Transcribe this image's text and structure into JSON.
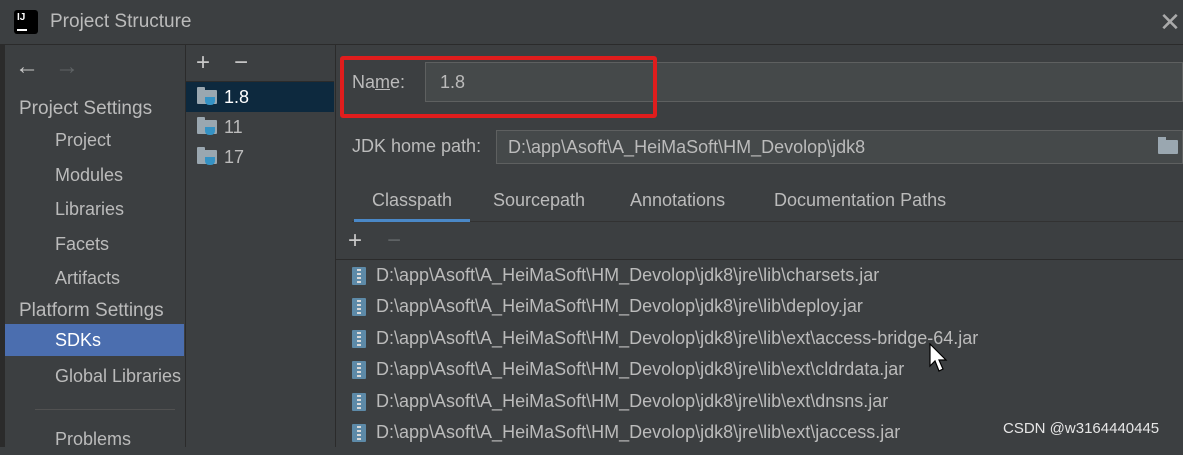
{
  "window": {
    "title": "Project Structure",
    "close": "✕"
  },
  "nav": {
    "back": "←",
    "forward": "→"
  },
  "sidebar": {
    "sections": [
      {
        "title": "Project Settings",
        "items": [
          "Project",
          "Modules",
          "Libraries",
          "Facets",
          "Artifacts"
        ]
      },
      {
        "title": "Platform Settings",
        "items": [
          "SDKs",
          "Global Libraries"
        ]
      }
    ],
    "problems": "Problems",
    "selected": "SDKs"
  },
  "sdk_panel": {
    "add": "+",
    "remove": "−",
    "sdks": [
      "1.8",
      "11",
      "17"
    ],
    "selected": "1.8"
  },
  "main": {
    "name_label_pre": "Na",
    "name_label_u": "m",
    "name_label_post": "e:",
    "name_value": "1.8",
    "jdk_label": "JDK home path:",
    "jdk_value": "D:\\app\\Asoft\\A_HeiMaSoft\\HM_Devolop\\jdk8",
    "tabs": [
      "Classpath",
      "Sourcepath",
      "Annotations",
      "Documentation Paths"
    ],
    "active_tab": "Classpath",
    "add": "+",
    "remove": "−",
    "classpath": [
      "D:\\app\\Asoft\\A_HeiMaSoft\\HM_Devolop\\jdk8\\jre\\lib\\charsets.jar",
      "D:\\app\\Asoft\\A_HeiMaSoft\\HM_Devolop\\jdk8\\jre\\lib\\deploy.jar",
      "D:\\app\\Asoft\\A_HeiMaSoft\\HM_Devolop\\jdk8\\jre\\lib\\ext\\access-bridge-64.jar",
      "D:\\app\\Asoft\\A_HeiMaSoft\\HM_Devolop\\jdk8\\jre\\lib\\ext\\cldrdata.jar",
      "D:\\app\\Asoft\\A_HeiMaSoft\\HM_Devolop\\jdk8\\jre\\lib\\ext\\dnsns.jar",
      "D:\\app\\Asoft\\A_HeiMaSoft\\HM_Devolop\\jdk8\\jre\\lib\\ext\\jaccess.jar"
    ]
  },
  "watermark": "CSDN @w3164440445",
  "colors": {
    "selection": "#4b6eaf",
    "highlight": "#e01d1d",
    "tab_underline": "#4a88c7"
  }
}
